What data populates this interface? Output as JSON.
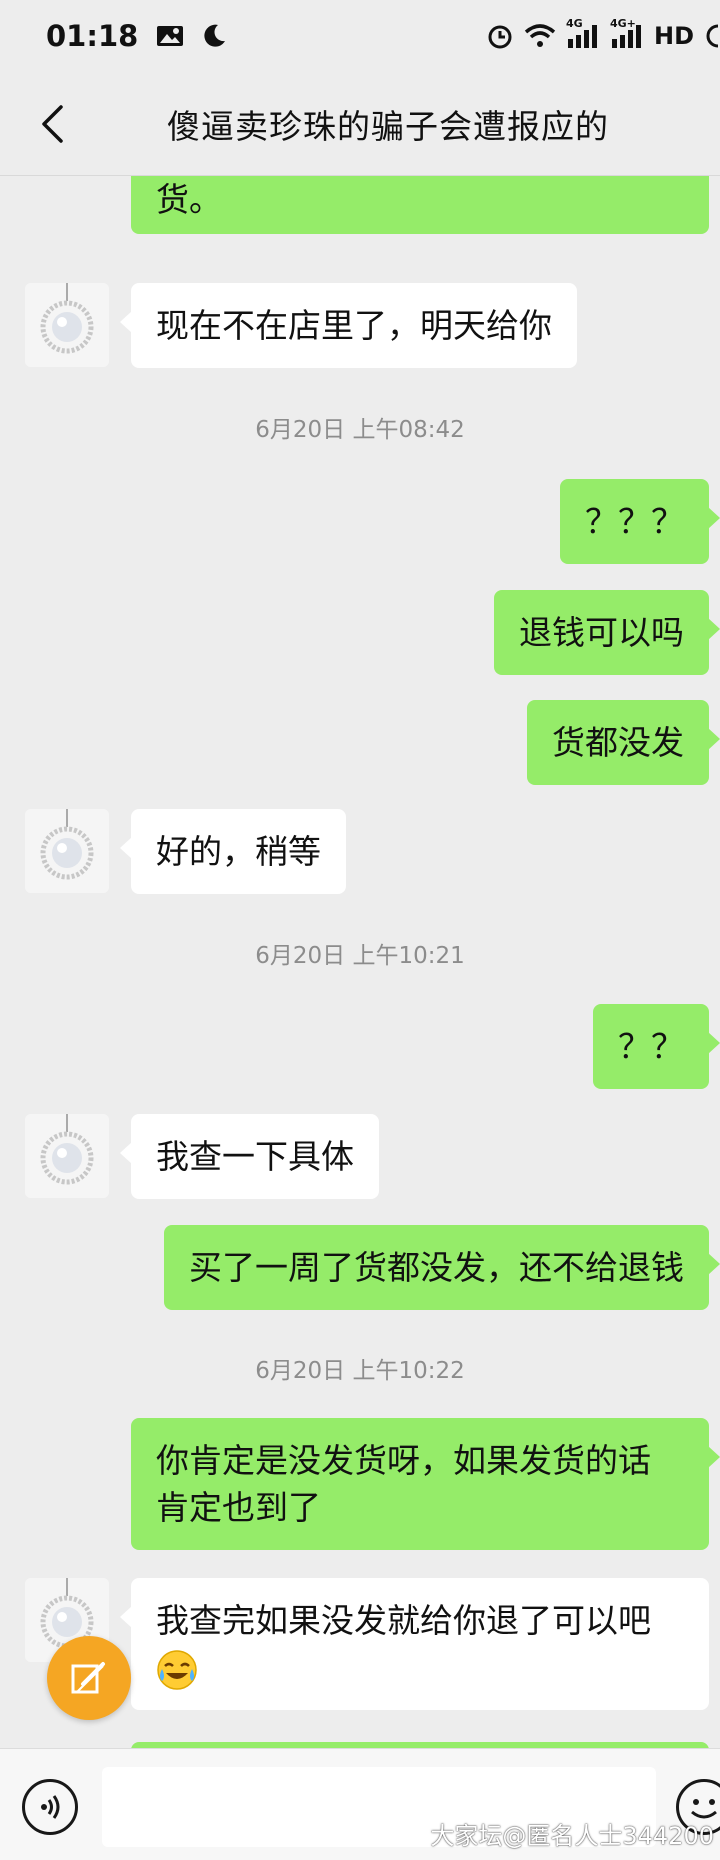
{
  "status_bar": {
    "time": "01:18",
    "network_4g_1": "4G",
    "network_4g_2": "4G+",
    "hd_label": "HD"
  },
  "header": {
    "back_icon": "chevron-left-icon",
    "title": "傻逼卖珍珠的骗子会遭报应的"
  },
  "messages": {
    "m0": "货。",
    "m1": "现在不在店里了，明天给你",
    "t1": "6月20日 上午08:42",
    "m2": "？？？",
    "m3": "退钱可以吗",
    "m4": "货都没发",
    "m5": "好的，稍等",
    "t2": "6月20日 上午10:21",
    "m6": "？？",
    "m7": "我查一下具体",
    "m8": "买了一周了货都没发，还不给退钱",
    "t3": "6月20日 上午10:22",
    "m9_line1": "你肯定是没发货呀，如果发货的话",
    "m9_line2": "肯定也到了",
    "m10_line1": "我查完如果没发就给你退了可以吧"
  },
  "input_bar": {
    "voice_icon": "voice-icon",
    "emoji_icon": "emoji-icon"
  },
  "fab_icon": "edit-icon",
  "watermark": "大家坛@匿名人士344200",
  "colors": {
    "self_bubble": "#95ec69",
    "other_bubble": "#ffffff",
    "background": "#ededed",
    "fab": "#f5a623"
  }
}
